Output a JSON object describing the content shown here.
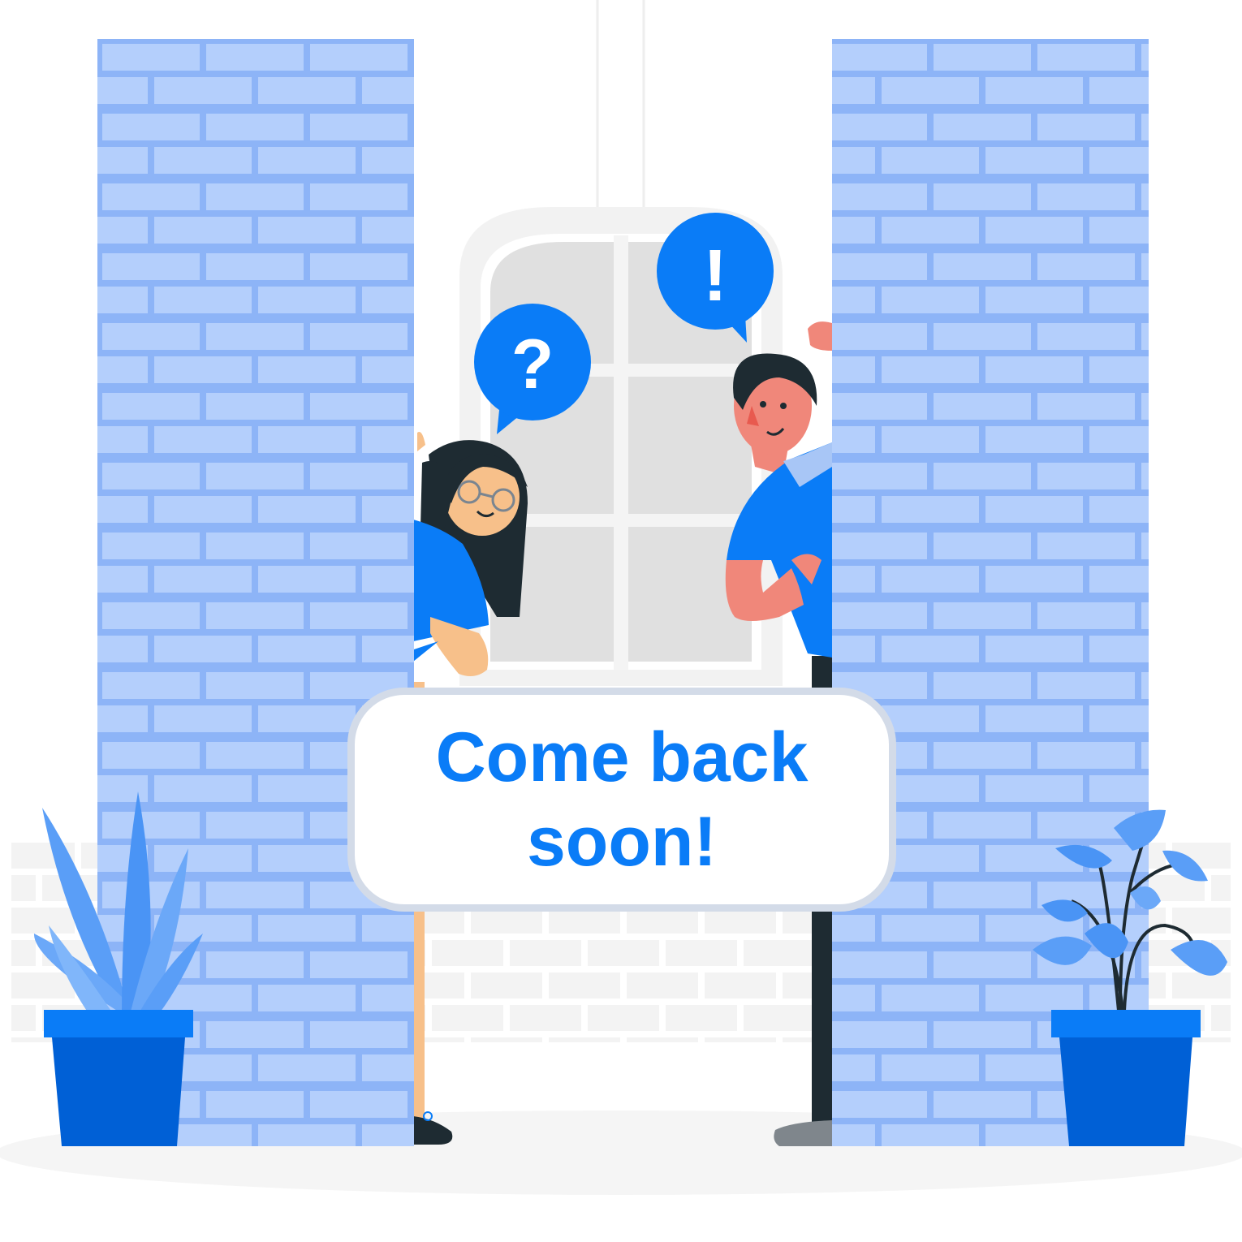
{
  "sign": {
    "text": "Come back soon!"
  },
  "bubbles": {
    "question": "?",
    "exclamation": "!"
  },
  "colors": {
    "brick_fill": "#b4cffc",
    "brick_mortar": "#8db4f7",
    "brand_blue": "#0a7cf7",
    "pot_blue": "#0060d6",
    "plant_blue": "#5a9ef7",
    "skin": "#f7c08a",
    "skin_man": "#f0877a",
    "hair": "#1e2b32",
    "window_glass": "#e0e0e0",
    "window_frame": "#f4f4f4",
    "sign_border": "#d3dbe8"
  },
  "icons": [
    "question-bubble-icon",
    "exclamation-bubble-icon",
    "agave-plant-icon",
    "leafy-plant-icon"
  ]
}
